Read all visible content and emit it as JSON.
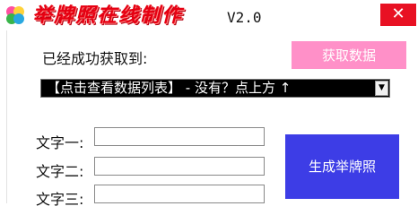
{
  "window": {
    "title": "举牌照在线制作",
    "version": "V2.0",
    "close_symbol": "✕"
  },
  "main": {
    "got_label": "已经成功获取到:",
    "fetch_button": "获取数据",
    "dropdown_selected": "【点击查看数据列表】 - 没有？点上方 ↑",
    "dropdown_arrow": "▼",
    "fields": [
      {
        "label": "文字一:",
        "value": ""
      },
      {
        "label": "文字二:",
        "value": ""
      },
      {
        "label": "文字三:",
        "value": ""
      }
    ],
    "generate_button": "生成举牌照"
  },
  "colors": {
    "title_red": "#e60012",
    "fetch_button_pink": "#ff90c8",
    "generate_button_blue": "#3d3de6",
    "close_red": "#e81123"
  },
  "icons": {
    "app_logo": "colorful-clover-logo",
    "dropdown": "chevron-down-icon",
    "close": "close-icon"
  }
}
